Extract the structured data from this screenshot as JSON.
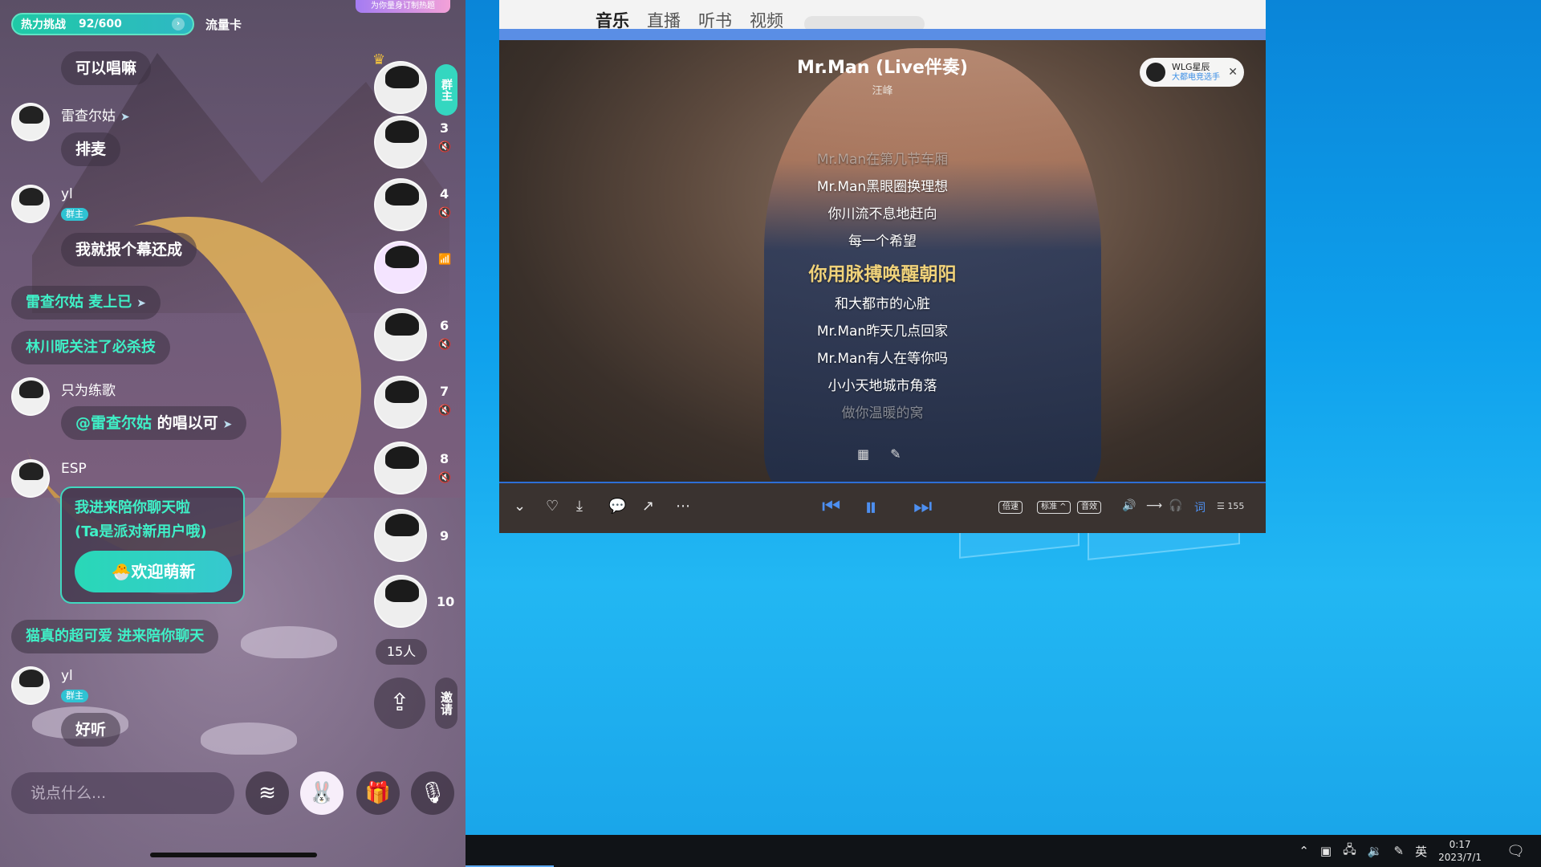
{
  "phone": {
    "challenge_label": "热力挑战",
    "challenge_progress": "92/600",
    "flow_card": "流量卡",
    "banner_tag": "为你量身订制热题",
    "messages": [
      {
        "text": "可以唱嘛"
      },
      {
        "user": "雷查尔姑",
        "text": "排麦"
      },
      {
        "user": "yl",
        "badge": "群主",
        "text": "我就报个幕还成"
      },
      {
        "system": "雷查尔姑 麦上已"
      },
      {
        "system": "林川昵关注了必杀技"
      },
      {
        "user": "只为练歌",
        "text_mention": "@雷查尔姑",
        "text_rest": "的唱以可"
      },
      {
        "user": "ESP"
      },
      {
        "system": "猫真的超可爱 进来陪你聊天"
      },
      {
        "user": "yl",
        "badge": "群主",
        "text": "好听"
      }
    ],
    "welcome_card": {
      "line1": "我进来陪你聊天啦",
      "line2": "(Ta是派对新用户哦)",
      "button": "🐣欢迎萌新"
    },
    "host_tag": "群主",
    "seat_numbers": [
      "3",
      "4",
      "6",
      "7",
      "8",
      "9",
      "10"
    ],
    "online_count": "15人",
    "invite_label": "邀请",
    "input_placeholder": "说点什么..."
  },
  "player": {
    "nav_items": [
      "音乐",
      "直播",
      "听书",
      "视频"
    ],
    "song_title": "Mr.Man (Live伴奏)",
    "singer": "汪峰",
    "lyrics": [
      {
        "text": "Mr.Man在第几节车厢",
        "state": "dim"
      },
      {
        "text": "Mr.Man黑眼圈换理想",
        "state": "normal"
      },
      {
        "text": "你川流不息地赶向",
        "state": "normal"
      },
      {
        "text": "每一个希望",
        "state": "normal"
      },
      {
        "text": "你用脉搏唤醒朝阳",
        "state": "active"
      },
      {
        "text": "和大都市的心脏",
        "state": "normal"
      },
      {
        "text": "Mr.Man昨天几点回家",
        "state": "normal"
      },
      {
        "text": "Mr.Man有人在等你吗",
        "state": "normal"
      },
      {
        "text": "小小天地城市角落",
        "state": "normal"
      },
      {
        "text": "做你温暖的窝",
        "state": "dim"
      }
    ],
    "radio_card": {
      "name": "WLG星辰",
      "sub": "大都电竞选手"
    },
    "chips": [
      "倍速",
      "标准 ^",
      "音效"
    ],
    "playlist_count": "155"
  },
  "taskbar": {
    "ime": "英",
    "time": "0:17",
    "date": "2023/7/1"
  }
}
